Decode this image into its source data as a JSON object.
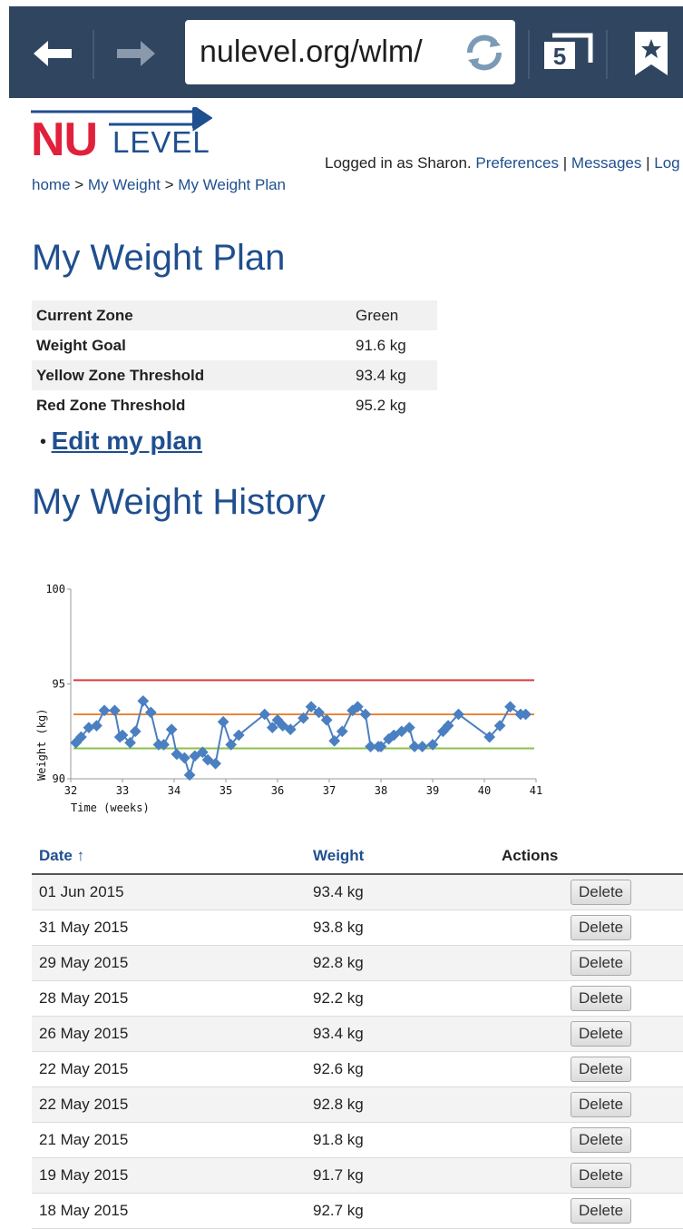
{
  "browser": {
    "url": "nulevel.org/wlm/",
    "tab_count": "5"
  },
  "header": {
    "logo_nu": "NU",
    "logo_level": "LEVEL",
    "breadcrumb": {
      "home": "home",
      "sep1": " > ",
      "my_weight": "My Weight",
      "sep2": " > ",
      "plan": "My Weight Plan"
    },
    "user": {
      "logged_in": "Logged in as Sharon.",
      "preferences": "Preferences",
      "sep1": " | ",
      "messages": "Messages",
      "sep2": " | ",
      "logout": "Log"
    }
  },
  "plan": {
    "title": "My Weight Plan",
    "rows": [
      {
        "label": "Current Zone",
        "value": "Green"
      },
      {
        "label": "Weight Goal",
        "value": "91.6 kg"
      },
      {
        "label": "Yellow Zone Threshold",
        "value": "93.4 kg"
      },
      {
        "label": "Red Zone Threshold",
        "value": "95.2 kg"
      }
    ],
    "edit_link": "Edit my plan"
  },
  "history": {
    "title": "My Weight History",
    "columns": {
      "date": "Date",
      "weight": "Weight",
      "actions": "Actions"
    },
    "rows": [
      {
        "date": "01 Jun 2015",
        "weight": "93.4 kg",
        "action": "Delete"
      },
      {
        "date": "31 May 2015",
        "weight": "93.8 kg",
        "action": "Delete"
      },
      {
        "date": "29 May 2015",
        "weight": "92.8 kg",
        "action": "Delete"
      },
      {
        "date": "28 May 2015",
        "weight": "92.2 kg",
        "action": "Delete"
      },
      {
        "date": "26 May 2015",
        "weight": "93.4 kg",
        "action": "Delete"
      },
      {
        "date": "22 May 2015",
        "weight": "92.6 kg",
        "action": "Delete"
      },
      {
        "date": "22 May 2015",
        "weight": "92.8 kg",
        "action": "Delete"
      },
      {
        "date": "21 May 2015",
        "weight": "91.8 kg",
        "action": "Delete"
      },
      {
        "date": "19 May 2015",
        "weight": "91.7 kg",
        "action": "Delete"
      },
      {
        "date": "18 May 2015",
        "weight": "92.7 kg",
        "action": "Delete"
      }
    ]
  },
  "chart_data": {
    "type": "line",
    "title": "",
    "xlabel": "Time (weeks)",
    "ylabel": "Weight (kg)",
    "xlim": [
      32,
      41
    ],
    "ylim": [
      90,
      100
    ],
    "x_ticks": [
      "32",
      "33",
      "34",
      "35",
      "36",
      "37",
      "38",
      "39",
      "40",
      "41"
    ],
    "y_ticks": [
      "90",
      "95",
      "100"
    ],
    "grid": false,
    "series": [
      {
        "color": "#4a7fc1",
        "x": [
          32.1,
          32.2,
          32.35,
          32.5,
          32.65,
          32.85,
          32.95,
          33.0,
          33.15,
          33.25,
          33.4,
          33.55,
          33.7,
          33.8,
          33.95,
          34.05,
          34.2,
          34.3,
          34.4,
          34.55,
          34.65,
          34.8,
          34.95,
          35.1,
          35.25,
          35.75,
          35.9,
          36.0,
          36.1,
          36.25,
          36.5,
          36.65,
          36.8,
          36.95,
          37.1,
          37.25,
          37.45,
          37.55,
          37.7,
          37.8,
          37.95,
          38.0,
          38.15,
          38.25,
          38.4,
          38.55,
          38.65,
          38.8,
          39.0,
          39.2,
          39.3,
          39.5,
          40.1,
          40.3,
          40.5,
          40.7,
          40.8
        ],
        "y": [
          91.9,
          92.2,
          92.7,
          92.8,
          93.6,
          93.6,
          92.2,
          92.3,
          91.9,
          92.5,
          94.1,
          93.5,
          91.8,
          91.8,
          92.6,
          91.3,
          91.1,
          90.2,
          91.2,
          91.4,
          91.0,
          90.8,
          93.0,
          91.8,
          92.3,
          93.4,
          92.7,
          93.1,
          92.8,
          92.6,
          93.2,
          93.8,
          93.5,
          93.1,
          92.0,
          92.5,
          93.6,
          93.8,
          93.4,
          91.7,
          91.7,
          91.7,
          92.1,
          92.3,
          92.5,
          92.7,
          91.7,
          91.7,
          91.8,
          92.5,
          92.8,
          93.4,
          92.2,
          92.8,
          93.8,
          93.4,
          93.4
        ]
      }
    ],
    "reference_lines": [
      {
        "y": 95.2,
        "color": "#d93b3b"
      },
      {
        "y": 93.4,
        "color": "#e8873c"
      },
      {
        "y": 91.6,
        "color": "#8cc04a"
      }
    ]
  }
}
